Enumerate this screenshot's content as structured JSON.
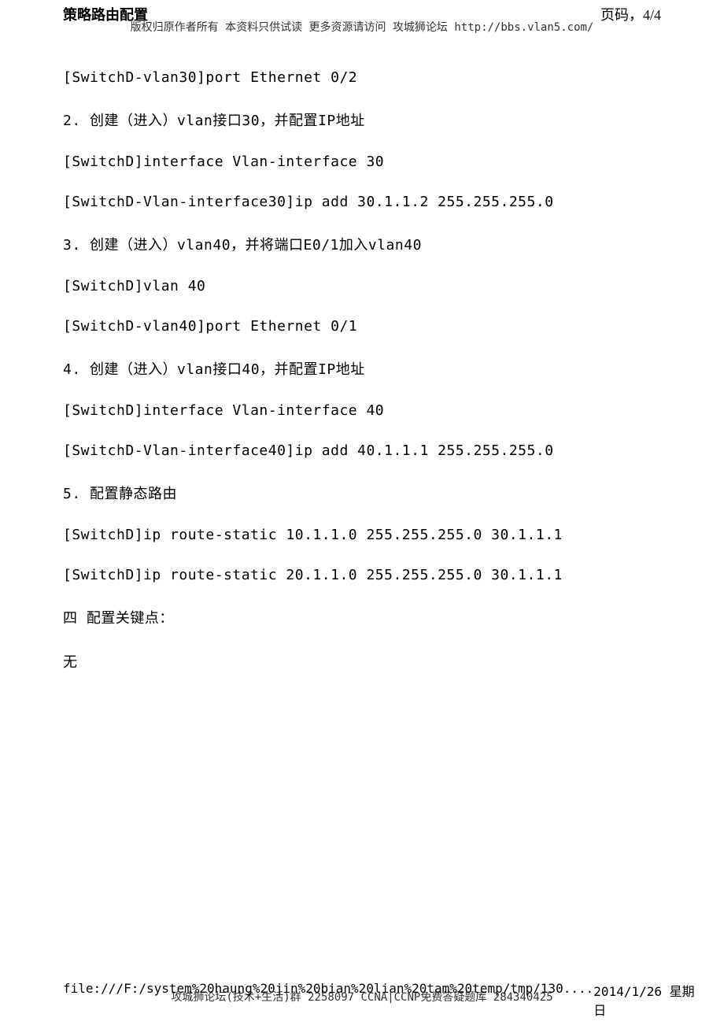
{
  "header": {
    "title": "策略路由配置",
    "page_label": "页码，4/4",
    "subtitle": "版权归原作者所有 本资料只供试读 更多资源请访问 攻城狮论坛 http://bbs.vlan5.com/"
  },
  "content": {
    "lines": [
      "[SwitchD-vlan30]port Ethernet 0/2",
      "2. 创建（进入）vlan接口30，并配置IP地址",
      "[SwitchD]interface Vlan-interface 30",
      "[SwitchD-Vlan-interface30]ip add 30.1.1.2 255.255.255.0",
      "3. 创建（进入）vlan40，并将端口E0/1加入vlan40",
      "[SwitchD]vlan 40",
      "[SwitchD-vlan40]port Ethernet 0/1",
      "4. 创建（进入）vlan接口40，并配置IP地址",
      "[SwitchD]interface Vlan-interface 40",
      "[SwitchD-Vlan-interface40]ip add 40.1.1.1 255.255.255.0",
      "5. 配置静态路由",
      "[SwitchD]ip route-static 10.1.1.0 255.255.255.0 30.1.1.1",
      "[SwitchD]ip route-static 20.1.1.0 255.255.255.0 30.1.1.1",
      "四  配置关键点：",
      "无"
    ]
  },
  "footer": {
    "top": "攻城狮论坛(技术+生活)群 2258097 CCNA|CCNP免费答疑题库 284340425",
    "path": "file:///F:/system%20haung%20jin%20bian%20lian%20tam%20temp/tmp/130....",
    "date": "2014/1/26 星期日"
  }
}
